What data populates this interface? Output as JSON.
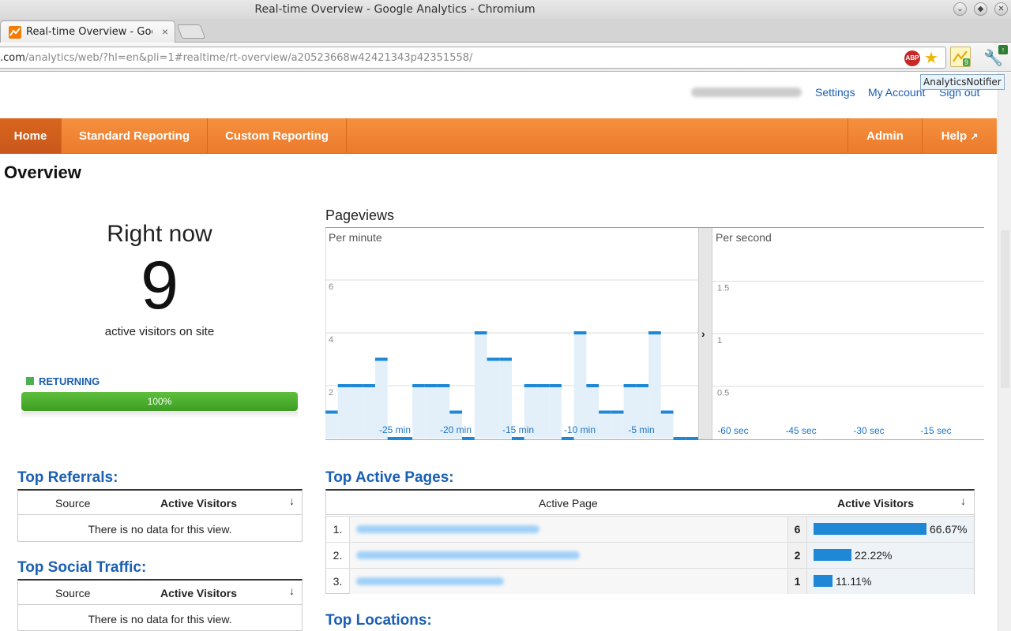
{
  "window": {
    "title": "Real-time Overview - Google Analytics - Chromium"
  },
  "tab": {
    "label": "Real-time Overview - Goo",
    "close": "×"
  },
  "address": {
    "host": ".com",
    "path": "/analytics/web/?hl=en&pli=1#realtime/rt-overview/a20523668w42421343p42351558/"
  },
  "extension": {
    "tooltip": "AnalyticsNotifier",
    "badge": "9",
    "abp": "ABP"
  },
  "header_links": {
    "settings": "Settings",
    "account": "My Account",
    "signout": "Sign out"
  },
  "nav": {
    "home": "Home",
    "standard": "Standard Reporting",
    "custom": "Custom Reporting",
    "admin": "Admin",
    "help": "Help"
  },
  "page": {
    "title": "Overview"
  },
  "right_now": {
    "label": "Right now",
    "count": "9",
    "subtitle": "active visitors on site",
    "legend": "RETURNING",
    "percent": "100%",
    "returning_fraction": 1.0
  },
  "pageviews": {
    "title": "Pageviews",
    "per_minute_label": "Per minute",
    "per_second_label": "Per second"
  },
  "chart_data": [
    {
      "type": "bar",
      "title": "Per minute",
      "ylim": [
        0,
        8
      ],
      "y_ticks": [
        "6",
        "4",
        "2"
      ],
      "x_tick_labels": [
        "-25 min",
        "-20 min",
        "-15 min",
        "-10 min",
        "-5 min"
      ],
      "values": [
        1,
        2,
        2,
        2,
        3,
        0,
        0,
        2,
        2,
        2,
        1,
        0,
        4,
        3,
        3,
        0,
        2,
        2,
        2,
        0,
        4,
        2,
        1,
        1,
        2,
        2,
        4,
        1,
        0,
        0
      ]
    },
    {
      "type": "bar",
      "title": "Per second",
      "ylim": [
        0,
        2
      ],
      "y_ticks": [
        "1.5",
        "1",
        "0.5"
      ],
      "x_tick_labels": [
        "-60 sec",
        "-45 sec",
        "-30 sec",
        "-15 sec"
      ],
      "values": []
    }
  ],
  "top_referrals": {
    "title": "Top Referrals:",
    "col_source": "Source",
    "col_visitors": "Active Visitors",
    "empty": "There is no data for this view."
  },
  "top_social": {
    "title": "Top Social Traffic:",
    "col_source": "Source",
    "col_visitors": "Active Visitors",
    "empty": "There is no data for this view."
  },
  "top_pages": {
    "title": "Top Active Pages:",
    "col_page": "Active Page",
    "col_visitors": "Active Visitors",
    "rows": [
      {
        "index": "1.",
        "count": "6",
        "pct": "66.67%",
        "fraction": 0.6667
      },
      {
        "index": "2.",
        "count": "2",
        "pct": "22.22%",
        "fraction": 0.2222
      },
      {
        "index": "3.",
        "count": "1",
        "pct": "11.11%",
        "fraction": 0.1111
      }
    ]
  },
  "top_locations": {
    "title": "Top Locations:"
  }
}
